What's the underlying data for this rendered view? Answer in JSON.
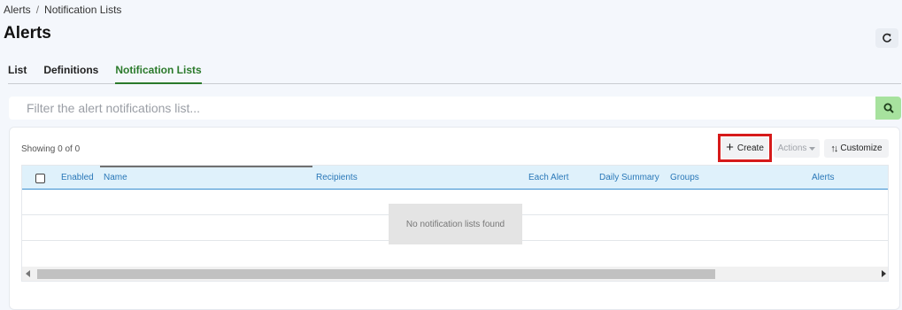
{
  "breadcrumb": {
    "parent": "Alerts",
    "separator": "/",
    "current": "Notification Lists"
  },
  "page": {
    "title": "Alerts"
  },
  "tabs": [
    {
      "label": "List",
      "active": false
    },
    {
      "label": "Definitions",
      "active": false
    },
    {
      "label": "Notification Lists",
      "active": true
    }
  ],
  "filter": {
    "placeholder": "Filter the alert notifications list...",
    "value": ""
  },
  "toolbar": {
    "showing": "Showing 0 of 0",
    "create_label": "Create",
    "actions_label": "Actions",
    "customize_label": "Customize"
  },
  "grid": {
    "columns": [
      "Enabled",
      "Name",
      "Recipients",
      "Each Alert",
      "Daily Summary",
      "Groups",
      "Alerts"
    ],
    "rows": [],
    "empty_message": "No notification lists found"
  },
  "colors": {
    "active_tab": "#2b7a2b",
    "search_button": "#a7e29e",
    "header_bg": "#dff1fb",
    "header_text": "#2a78b8",
    "highlight": "#d61a1a"
  }
}
